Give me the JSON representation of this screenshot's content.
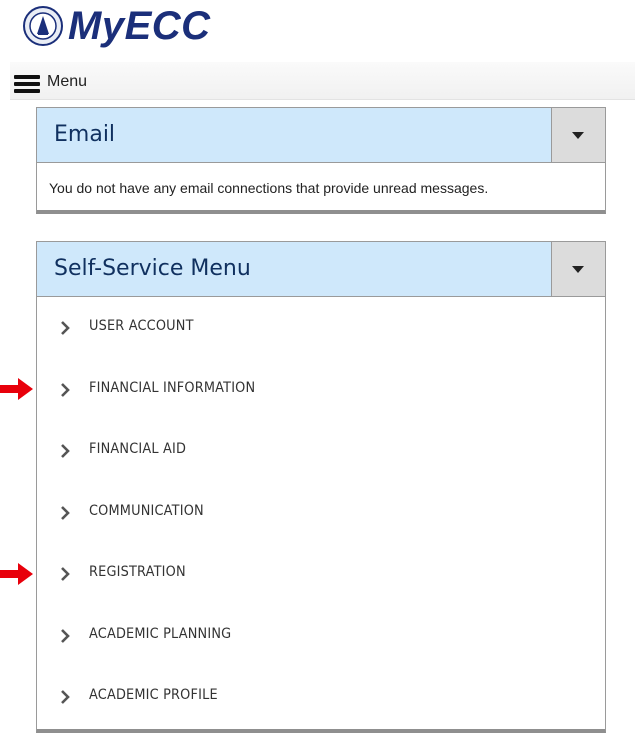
{
  "app": {
    "brand": "MyECC",
    "seal_icon": "college-seal-icon",
    "brand_color": "#1b2f7a"
  },
  "nav": {
    "menu_label": "Menu",
    "menu_icon": "hamburger-icon"
  },
  "email_panel": {
    "title": "Email",
    "message": "You do not have any email connections that provide unread messages.",
    "toggle_icon": "caret-down-icon"
  },
  "self_service": {
    "title": "Self-Service Menu",
    "toggle_icon": "caret-down-icon",
    "items": [
      {
        "label": "USER ACCOUNT"
      },
      {
        "label": "FINANCIAL INFORMATION"
      },
      {
        "label": "FINANCIAL AID"
      },
      {
        "label": "COMMUNICATION"
      },
      {
        "label": "REGISTRATION"
      },
      {
        "label": "ACADEMIC PLANNING"
      },
      {
        "label": "ACADEMIC PROFILE"
      }
    ]
  },
  "colors": {
    "header_bg": "#cfe8fb",
    "header_text": "#10305f",
    "annotation_arrow": "#e8000b"
  }
}
